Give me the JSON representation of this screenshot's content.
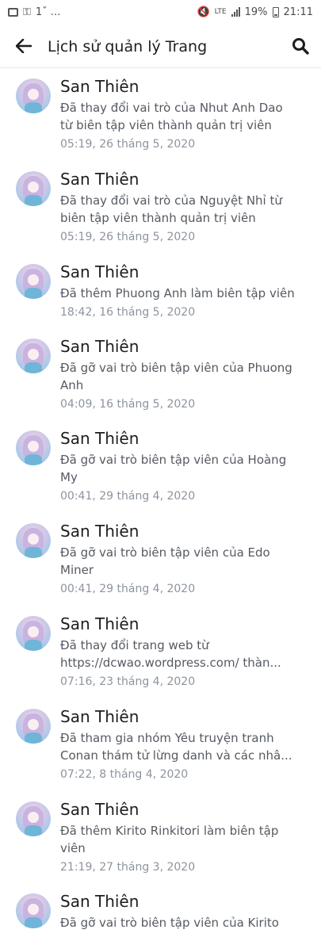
{
  "status_bar": {
    "left_text": "1ˇ ...",
    "network": "LTE",
    "battery": "19%",
    "time": "21:11"
  },
  "header": {
    "title": "Lịch sử quản lý Trang"
  },
  "entries": [
    {
      "name": "San Thiên",
      "description": "Đã thay đổi vai trò của Nhut Anh Dao từ biên tập viên thành quản trị viên",
      "time": "05:19, 26 tháng 5, 2020"
    },
    {
      "name": "San Thiên",
      "description": "Đã thay đổi vai trò của Nguyệt Nhỉ từ biên tập viên thành quản trị viên",
      "time": "05:19, 26 tháng 5, 2020"
    },
    {
      "name": "San Thiên",
      "description": "Đã thêm Phuong Anh làm biên tập viên",
      "time": "18:42, 16 tháng 5, 2020"
    },
    {
      "name": "San Thiên",
      "description": "Đã gỡ vai trò biên tập viên của Phuong Anh",
      "time": "04:09, 16 tháng 5, 2020"
    },
    {
      "name": "San Thiên",
      "description": "Đã gỡ vai trò biên tập viên của Hoàng My",
      "time": "00:41, 29 tháng 4, 2020"
    },
    {
      "name": "San Thiên",
      "description": "Đã gỡ vai trò biên tập viên của Edo Miner",
      "time": "00:41, 29 tháng 4, 2020"
    },
    {
      "name": "San Thiên",
      "description": "Đã thay đổi trang web từ https://dcwao.wordpress.com/ thàn...",
      "time": "07:16, 23 tháng 4, 2020"
    },
    {
      "name": "San Thiên",
      "description": "Đã tham gia nhóm Yêu truyện tranh Conan thám tử lừng danh và các nhâ...",
      "time": "07:22, 8 tháng 4, 2020"
    },
    {
      "name": "San Thiên",
      "description": "Đã thêm Kirito Rinkitori làm biên tập viên",
      "time": "21:19, 27 tháng 3, 2020"
    },
    {
      "name": "San Thiên",
      "description": "Đã gỡ vai trò biên tập viên của Kirito",
      "time": ""
    }
  ]
}
